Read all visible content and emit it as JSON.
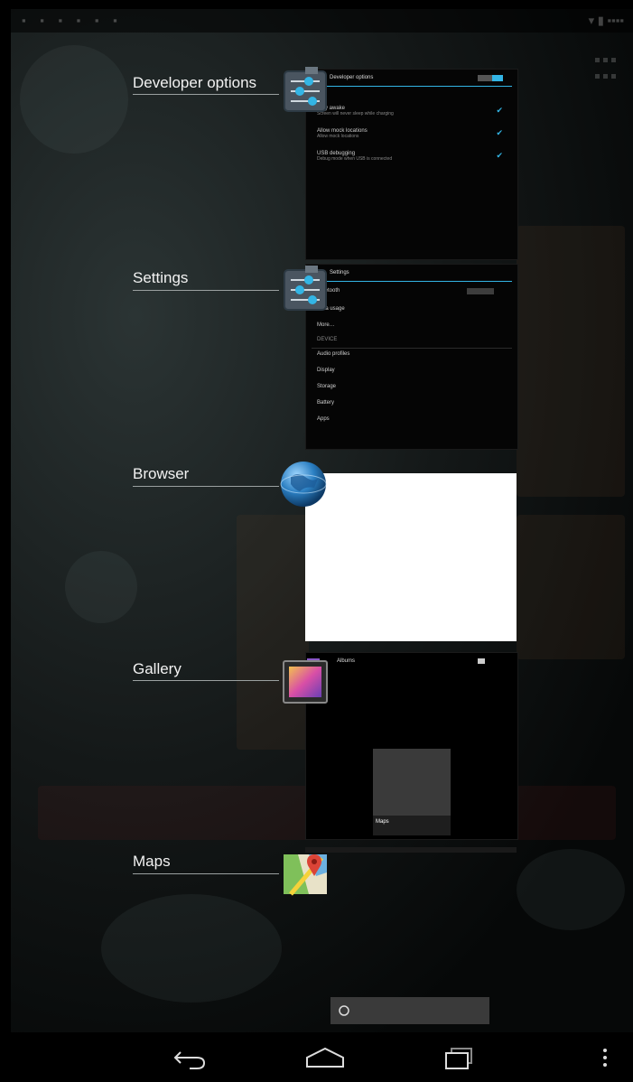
{
  "recents": [
    {
      "label": "Developer options",
      "icon": "settings-sliders-icon"
    },
    {
      "label": "Settings",
      "icon": "settings-sliders-icon"
    },
    {
      "label": "Browser",
      "icon": "globe-icon"
    },
    {
      "label": "Gallery",
      "icon": "gallery-photo-icon"
    },
    {
      "label": "Maps",
      "icon": "maps-pin-icon"
    }
  ],
  "devopts_thumb": {
    "title": "Developer options",
    "items": [
      {
        "title": "Stay awake",
        "sub": "Screen will never sleep while charging"
      },
      {
        "title": "Allow mock locations",
        "sub": "Allow mock locations"
      },
      {
        "title": "USB debugging",
        "sub": "Debug mode when USB is connected"
      }
    ]
  },
  "settings_thumb": {
    "title": "Settings",
    "items": [
      "Bluetooth",
      "Data usage",
      "More…",
      "DEVICE",
      "Audio profiles",
      "Display",
      "Storage",
      "Battery",
      "Apps"
    ]
  },
  "gallery_thumb": {
    "title": "Albums",
    "album": "Maps"
  },
  "colors": {
    "accent": "#33b5e5"
  },
  "navbar": {
    "back": "back-icon",
    "home": "home-icon",
    "recents": "recent-apps-icon",
    "menu": "overflow-menu-icon"
  }
}
